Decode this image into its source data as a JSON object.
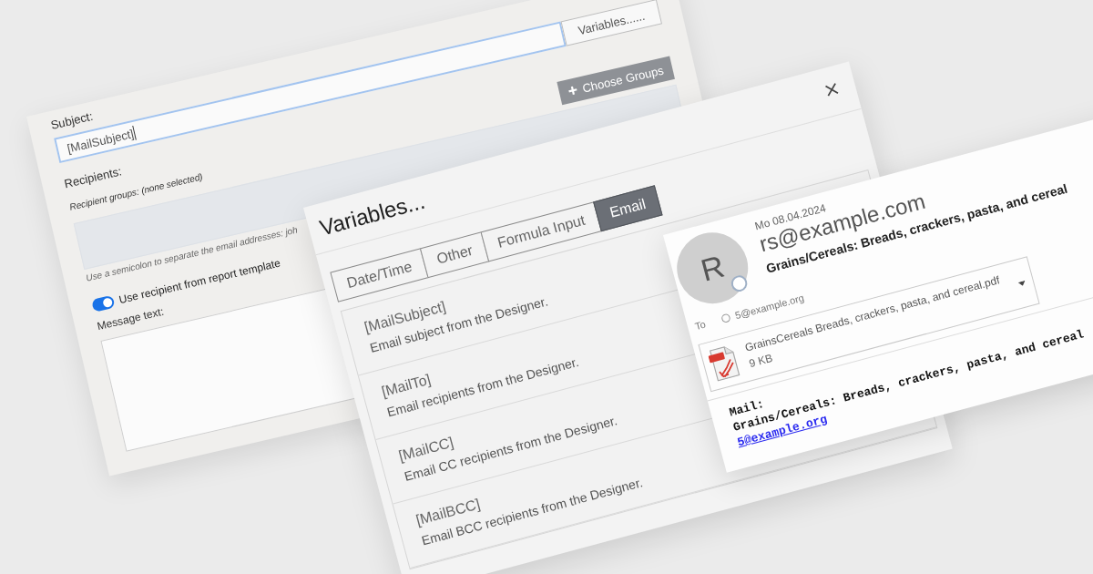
{
  "settings_dialog": {
    "subject": {
      "label": "Subject:",
      "value": "[MailSubject]",
      "focused": true
    },
    "variables_button": "Variables......",
    "recipients": {
      "label": "Recipients:",
      "groups_text": "Recipient groups: (none selected)",
      "choose_groups_button": "Choose Groups",
      "addresses_field": {
        "disabled": true
      },
      "hint": "Use a semicolon to separate the email addresses: joh"
    },
    "use_template_recipient": {
      "label": "Use recipient from report template",
      "checked": true
    },
    "message": {
      "label": "Message text:"
    }
  },
  "variables_dialog": {
    "title": "Variables...",
    "tabs": [
      {
        "label": "Date/Time",
        "selected": false
      },
      {
        "label": "Other",
        "selected": false
      },
      {
        "label": "Formula Input",
        "selected": false
      },
      {
        "label": "Email",
        "selected": true
      }
    ],
    "items": [
      {
        "name": "[MailSubject]",
        "description": "Email subject from the Designer."
      },
      {
        "name": "[MailTo]",
        "description": "Email recipients from the Designer."
      },
      {
        "name": "[MailCC]",
        "description": "Email CC recipients from the Designer."
      },
      {
        "name": "[MailBCC]",
        "description": "Email BCC recipients from the Designer."
      }
    ]
  },
  "email_preview": {
    "avatar_initial": "R",
    "date": "Mo 08.04.2024",
    "sender": "rs@example.com",
    "subject": "Grains/Cereals: Breads, crackers, pasta, and cereal",
    "to_label": "To",
    "to_address": "5@example.org",
    "attachment": {
      "name": "GrainsCereals Breads, crackers, pasta, and cereal.pdf",
      "size": "9 KB"
    },
    "body_lines": [
      "Mail:",
      "Grains/Cereals: Breads, crackers, pasta, and cereal"
    ],
    "body_link": "5@example.org"
  }
}
